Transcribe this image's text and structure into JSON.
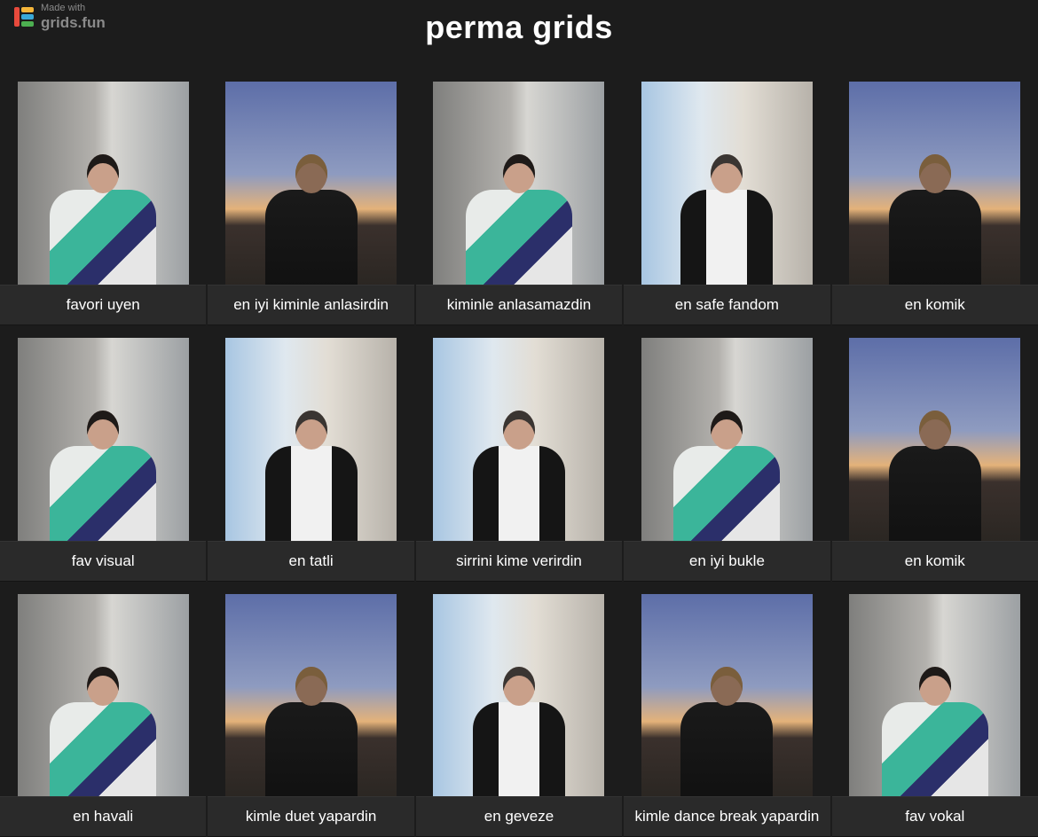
{
  "brand": {
    "made_with": "Made with",
    "name": "grids.fun",
    "logo_colors": [
      "#e84a3c",
      "#f5b63a",
      "#3aa9d8",
      "#4caf50"
    ]
  },
  "title": "perma grids",
  "colors": {
    "background": "#1c1c1c",
    "caption_bg": "#2a2a2a",
    "text": "#ffffff"
  },
  "cells": [
    {
      "caption": "favori uyen",
      "scene": "wall"
    },
    {
      "caption": "en iyi kiminle anlasirdin",
      "scene": "sunset"
    },
    {
      "caption": "kiminle anlasamazdin",
      "scene": "wall"
    },
    {
      "caption": "en safe fandom",
      "scene": "room"
    },
    {
      "caption": "en komik",
      "scene": "sunset"
    },
    {
      "caption": "fav visual",
      "scene": "wall"
    },
    {
      "caption": "en tatli",
      "scene": "room"
    },
    {
      "caption": "sirrini kime verirdin",
      "scene": "room"
    },
    {
      "caption": "en iyi bukle",
      "scene": "wall"
    },
    {
      "caption": "en komik",
      "scene": "sunset"
    },
    {
      "caption": "en havali",
      "scene": "wall"
    },
    {
      "caption": "kimle duet yapardin",
      "scene": "sunset"
    },
    {
      "caption": "en geveze",
      "scene": "room"
    },
    {
      "caption": "kimle dance break yapardin",
      "scene": "sunset"
    },
    {
      "caption": "fav vokal",
      "scene": "wall"
    }
  ]
}
